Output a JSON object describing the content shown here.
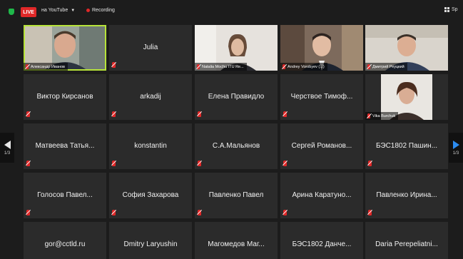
{
  "topbar": {
    "live_label": "LIVE",
    "live_target": "на YouTube",
    "recording_label": "Recording",
    "view_label": "Sp"
  },
  "navigation": {
    "page_indicator_left": "1/3",
    "page_indicator_right": "1/3"
  },
  "colors": {
    "live_badge": "#e02828",
    "active_speaker_border": "#b7e33a",
    "mute_icon": "#e02828",
    "next_page_arrow": "#2c8cf0",
    "security_shield": "#1fb84a"
  },
  "video_tiles": [
    {
      "name": "Александр Иванов",
      "active_speaker": true
    },
    {
      "name": "Natalia Mochu ITU Re..."
    },
    {
      "name": "Andrey Vorobyev (...)"
    },
    {
      "name": "Дмитрий Реуцкий"
    },
    {
      "name": "Vika Burchuk"
    }
  ],
  "name_tiles": [
    "Julia",
    "Виктор Кирсанов",
    "arkadij",
    "Елена Правидло",
    "Черствое Тимоф...",
    "Матвеева Татья...",
    "konstantin",
    "С.А.Мальянов",
    "Сергей Романов...",
    "БЭС1802 Пашин...",
    "Голосов Павел...",
    "София Захарова",
    "Павленко Павел",
    "Арина Каратуно...",
    "Павленко Ирина...",
    "gor@cctld.ru",
    "Dmitry Laryushin",
    "Магомедов Маг...",
    "БЭС1802 Данче...",
    "Daria Perepeliatni..."
  ]
}
